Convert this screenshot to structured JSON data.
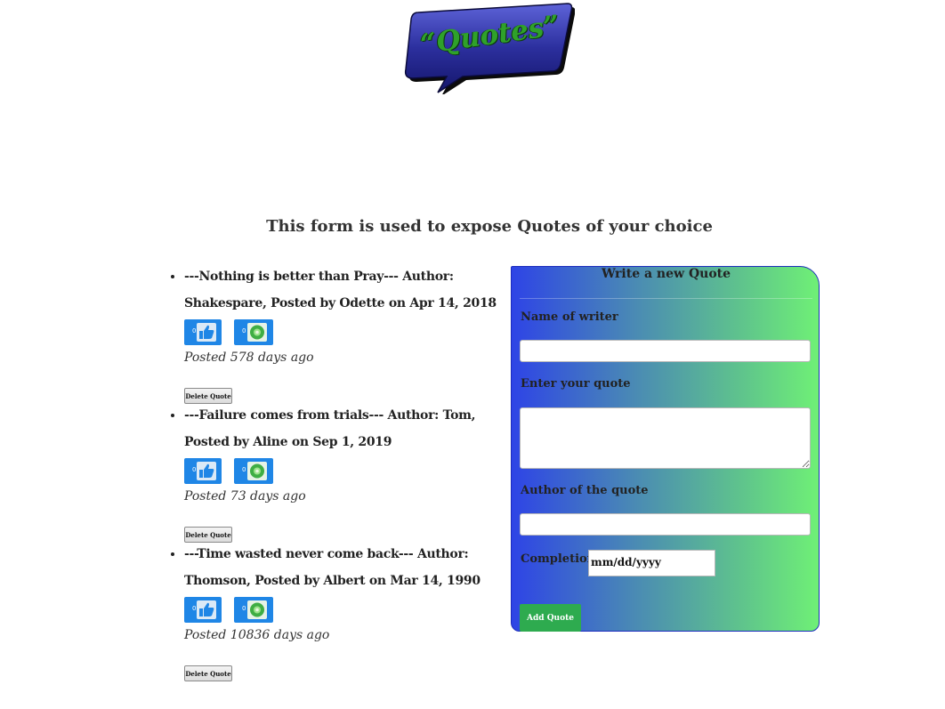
{
  "logo": {
    "text": "“Quotes”"
  },
  "heading": "This form is used to expose Quotes of your choice",
  "quotes": [
    {
      "text": "---Nothing is better than Pray--- Author: Shakespare, Posted by Odette on Apr 14, 2018",
      "likes": "0",
      "dislikes": "0",
      "posted_ago": "Posted 578 days ago",
      "delete_label": "Delete Quote"
    },
    {
      "text": "---Failure comes from trials--- Author: Tom, Posted by Aline on Sep 1, 2019",
      "likes": "0",
      "dislikes": "0",
      "posted_ago": "Posted 73 days ago",
      "delete_label": "Delete Quote"
    },
    {
      "text": "---Time wasted never come back--- Author: Thomson, Posted by Albert on Mar 14, 1990",
      "likes": "0",
      "dislikes": "0",
      "posted_ago": "Posted 10836 days ago",
      "delete_label": "Delete Quote"
    }
  ],
  "form": {
    "title": "Write a new Quote",
    "writer_label": "Name of writer",
    "quote_label": "Enter your quote",
    "author_label": "Author of the quote",
    "completion_label": "Completion",
    "date_placeholder": "mm/dd/yyyy",
    "submit_label": "Add Quote"
  },
  "icons": {
    "like": "thumbs-up-icon",
    "dislike": "dislike-orb-icon"
  },
  "colors": {
    "vote_button": "#1f86e6",
    "add_button": "#2eab4f",
    "form_gradient_start": "#2e44e6",
    "form_gradient_end": "#6ff076",
    "logo_bubble": "#2c2f9e",
    "logo_text": "#2fa12a"
  }
}
